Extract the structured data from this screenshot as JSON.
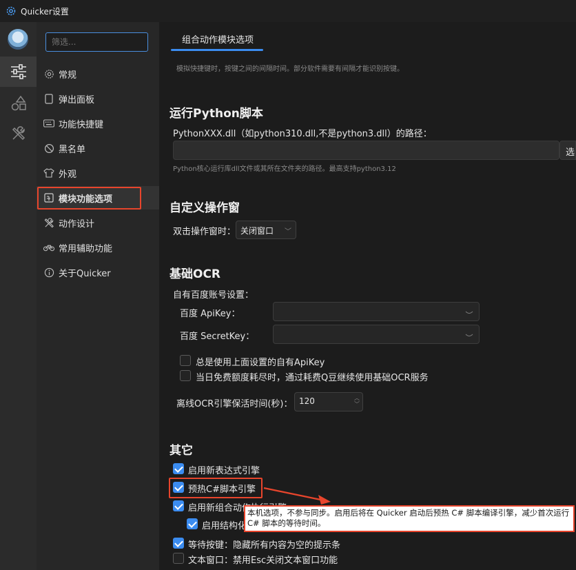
{
  "window": {
    "title": "Quicker设置"
  },
  "search": {
    "placeholder": "筛选..."
  },
  "nav": [
    {
      "label": "常规",
      "icon": "gear-icon"
    },
    {
      "label": "弹出面板",
      "icon": "panel-icon"
    },
    {
      "label": "功能快捷键",
      "icon": "keyboard-icon"
    },
    {
      "label": "黑名单",
      "icon": "block-icon"
    },
    {
      "label": "外观",
      "icon": "shirt-icon"
    },
    {
      "label": "模块功能选项",
      "icon": "module-icon"
    },
    {
      "label": "动作设计",
      "icon": "tools-icon"
    },
    {
      "label": "常用辅助功能",
      "icon": "bike-icon"
    },
    {
      "label": "关于Quicker",
      "icon": "info-icon"
    }
  ],
  "main": {
    "tab": "组合动作模块选项",
    "tab_hint": "模拟快捷键时，按键之间的间隔时间。部分软件需要有间隔才能识别按键。",
    "python": {
      "title": "运行Python脚本",
      "path_label": "PythonXXX.dll（如python310.dll,不是python3.dll）的路径：",
      "path_value": "",
      "browse_label": "选",
      "hint": "Python核心运行库dll文件或其所在文件夹的路径。最高支持python3.12"
    },
    "custom_window": {
      "title": "自定义操作窗",
      "dblclick_label": "双击操作窗时：",
      "dblclick_value": "关闭窗口"
    },
    "ocr": {
      "title": "基础OCR",
      "own_account_label": "自有百度账号设置：",
      "apikey_label": "百度 ApiKey：",
      "secretkey_label": "百度 SecretKey：",
      "always_use_own": "总是使用上面设置的自有ApiKey",
      "use_qbeans": "当日免费额度耗尽时，通过耗费Q豆继续使用基础OCR服务",
      "keepalive_label": "离线OCR引擎保活时间(秒)：",
      "keepalive_value": "120"
    },
    "other": {
      "title": "其它",
      "items": [
        {
          "label": "启用新表达式引擎",
          "checked": true
        },
        {
          "label": "预热C#脚本引擎",
          "checked": true
        },
        {
          "label": "启用新组合动作执行引擎",
          "checked": true
        },
        {
          "label": "启用结构化",
          "checked": true
        },
        {
          "label": "等待按键：隐藏所有内容为空的提示条",
          "checked": true
        },
        {
          "label": "文本窗口：禁用Esc关闭文本窗口功能",
          "checked": false
        }
      ]
    }
  },
  "tooltip": {
    "text": "本机选项，不参与同步。启用后将在 Quicker 启动后预热 C# 脚本编译引擎，减少首次运行 C# 脚本的等待时间。"
  },
  "colors": {
    "accent": "#3b8cf0",
    "highlight": "#e8452c"
  }
}
